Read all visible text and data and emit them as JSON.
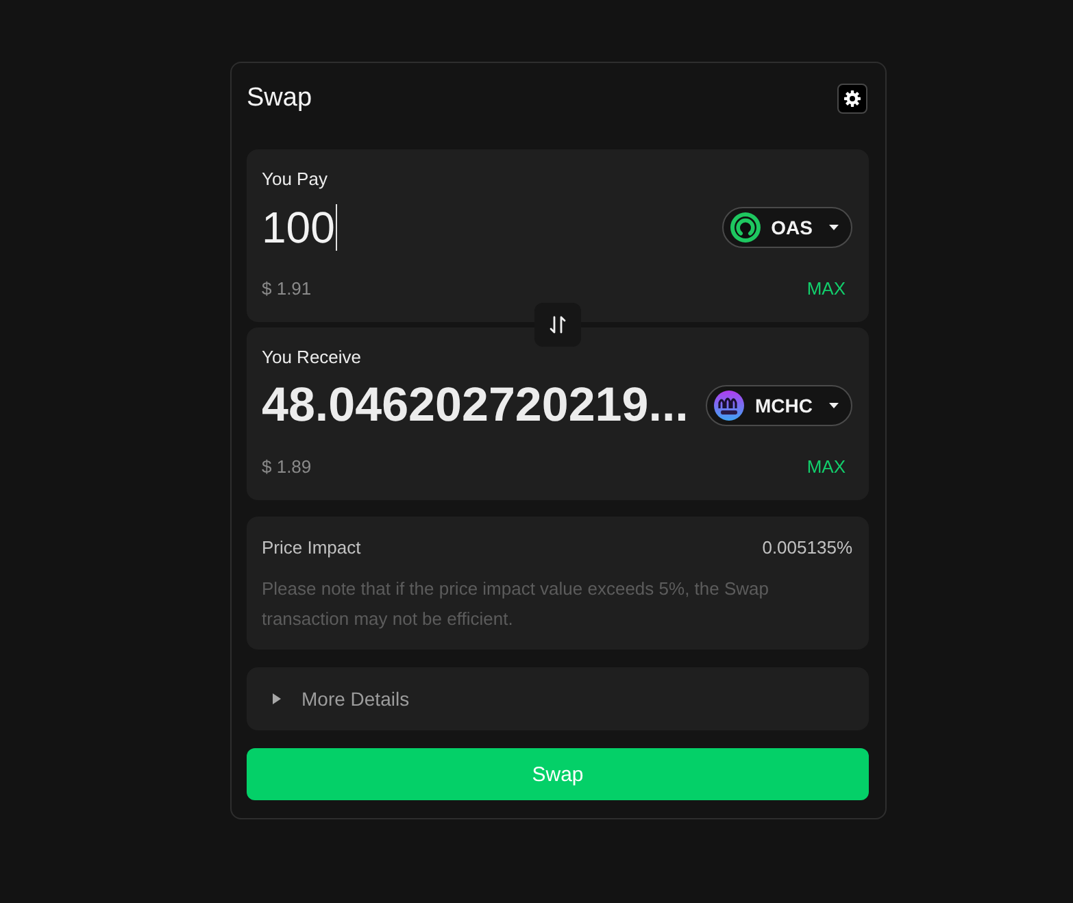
{
  "header": {
    "title": "Swap"
  },
  "panels": [
    {
      "kind": "input",
      "label": "You Pay",
      "amount": "100",
      "focused": true,
      "token": "OAS",
      "usd": "$ 1.91",
      "max": "MAX"
    },
    {
      "kind": "output",
      "label": "You Receive",
      "amount": "48.046202720219...",
      "focused": false,
      "token": "MCHC",
      "usd": "$ 1.89",
      "max": "MAX"
    }
  ],
  "price_impact": {
    "label": "Price Impact",
    "value": "0.005135%",
    "note": "Please note that if the price impact value exceeds 5%, the Swap transaction may not be efficient."
  },
  "more_details": {
    "label": "More Details",
    "expanded": false
  },
  "swap_button": {
    "label": "Swap"
  }
}
